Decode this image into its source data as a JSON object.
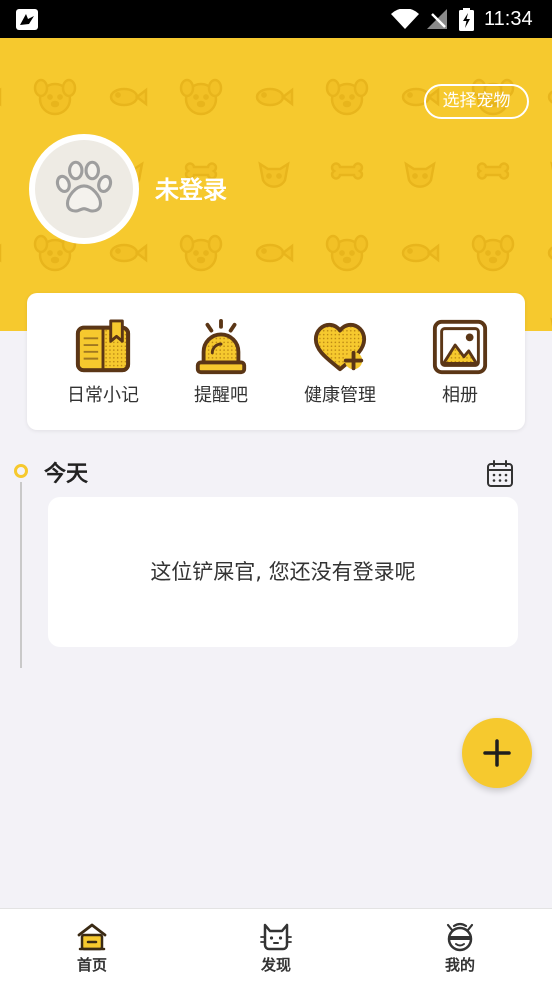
{
  "status_bar": {
    "time": "11:34",
    "icons": [
      "notification-icon",
      "wifi-icon",
      "no-signal-icon",
      "battery-charging-icon"
    ]
  },
  "header": {
    "select_pet_label": "选择宠物",
    "login_status": "未登录",
    "avatar_icon": "paw-icon"
  },
  "quick_actions": [
    {
      "label": "日常小记",
      "icon": "notebook-icon"
    },
    {
      "label": "提醒吧",
      "icon": "alarm-light-icon"
    },
    {
      "label": "健康管理",
      "icon": "heart-plus-icon"
    },
    {
      "label": "相册",
      "icon": "photo-album-icon"
    }
  ],
  "timeline": {
    "title": "今天",
    "calendar_icon": "calendar-icon",
    "empty_message": "这位铲屎官, 您还没有登录呢"
  },
  "fab": {
    "icon": "plus-icon"
  },
  "bottom_nav": [
    {
      "label": "首页",
      "icon": "home-icon",
      "active": true
    },
    {
      "label": "发现",
      "icon": "cat-icon",
      "active": false
    },
    {
      "label": "我的",
      "icon": "pet-profile-icon",
      "active": false
    }
  ],
  "colors": {
    "accent": "#F6C92E",
    "icon_brown": "#5B3616",
    "background": "#F3F2F7",
    "text": "#333333"
  }
}
